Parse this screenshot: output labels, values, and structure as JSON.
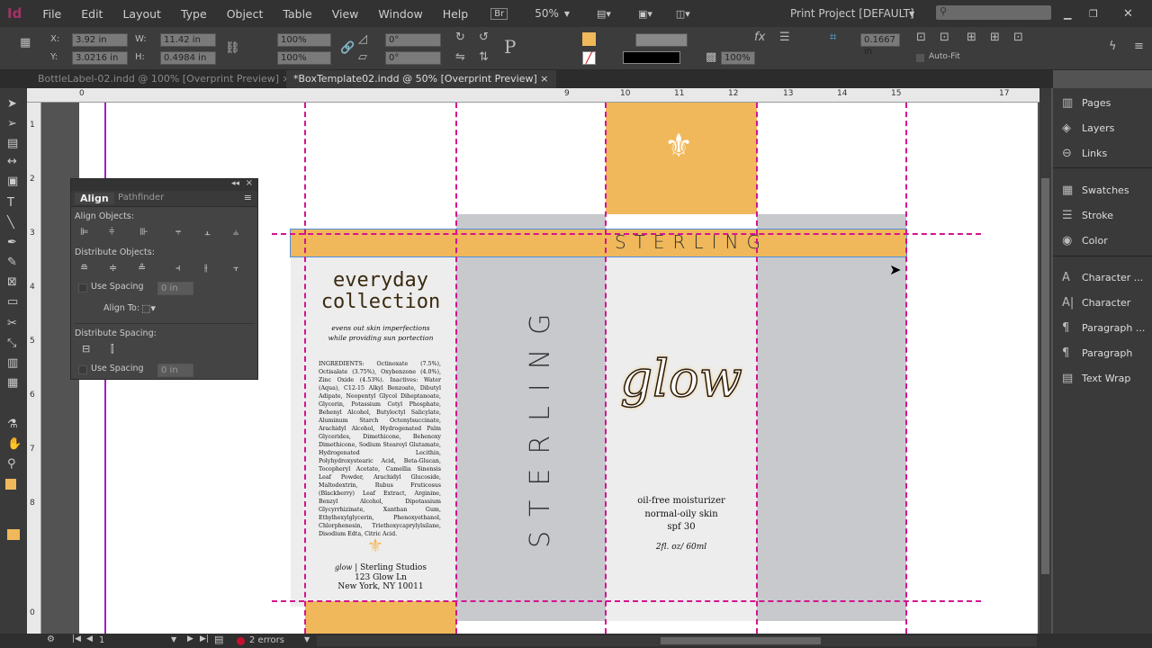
{
  "app": {
    "logo": "Id",
    "menus": [
      "File",
      "Edit",
      "Layout",
      "Type",
      "Object",
      "Table",
      "View",
      "Window",
      "Help"
    ],
    "bridge": "Br",
    "zoom": "50%",
    "workspace": "Print Project [DEFAULT]",
    "search_placeholder": ""
  },
  "control": {
    "x_label": "X:",
    "x": "3.92 in",
    "y_label": "Y:",
    "y": "3.0216 in",
    "w_label": "W:",
    "w": "11.42 in",
    "h_label": "H:",
    "h": "0.4984 in",
    "scale_x": "100%",
    "scale_y": "100%",
    "rotate": "0°",
    "shear": "0°",
    "stroke_weight": "",
    "opacity": "100%",
    "frame_offset": "0.1667 in",
    "autofit": "Auto-Fit",
    "fill_color": "#f0b85a"
  },
  "tabs": [
    {
      "label": "BottleLabel-02.indd @ 100% [Overprint Preview]",
      "active": false
    },
    {
      "label": "*BoxTemplate02.indd @ 50% [Overprint Preview]",
      "active": true
    }
  ],
  "ruler": {
    "top": [
      "0",
      "9",
      "10",
      "11",
      "12",
      "13",
      "14",
      "15",
      "17"
    ],
    "left": [
      "1",
      "2",
      "3",
      "4",
      "5",
      "6",
      "7",
      "8",
      "0"
    ]
  },
  "align_panel": {
    "tab_align": "Align",
    "tab_pathfinder": "Pathfinder",
    "align_objects": "Align Objects:",
    "distribute_objects": "Distribute Objects:",
    "use_spacing": "Use Spacing",
    "spacing_value": "0 in",
    "align_to": "Align To:",
    "distribute_spacing": "Distribute Spacing:",
    "use_spacing2": "Use Spacing",
    "spacing_value2": "0 in"
  },
  "right_panel": {
    "items": [
      {
        "label": "Pages",
        "icon": "pages-icon"
      },
      {
        "label": "Layers",
        "icon": "layers-icon"
      },
      {
        "label": "Links",
        "icon": "links-icon"
      },
      {
        "label": "Swatches",
        "icon": "swatches-icon"
      },
      {
        "label": "Stroke",
        "icon": "stroke-icon"
      },
      {
        "label": "Color",
        "icon": "color-icon"
      },
      {
        "label": "Character ...",
        "icon": "character-styles-icon"
      },
      {
        "label": "Character",
        "icon": "character-icon"
      },
      {
        "label": "Paragraph ...",
        "icon": "paragraph-styles-icon"
      },
      {
        "label": "Paragraph",
        "icon": "paragraph-icon"
      },
      {
        "label": "Text Wrap",
        "icon": "text-wrap-icon"
      }
    ]
  },
  "design": {
    "banner": "STERLING",
    "side_vertical": "STERLING",
    "headline1": "everyday",
    "headline2": "collection",
    "tagline1": "evens out skin imperfections",
    "tagline2": "while providing sun portection",
    "ingredients": "INGREDIENTS: Octinoxate (7.5%), Octisalate (3.75%), Oxybenzone (4.0%), Zinc Oxide (4.53%). Inactives: Water (Aqua), C12-15 Alkyl Benzoate, Dibutyl Adipate, Neopentyl Glycol Diheptanoate, Glycerin, Potassium Cetyl Phosphate, Behenyl Alcohol, Butyloctyl Salicylate, Aluminum Starch Octenylsuccinate, Arachidyl Alcohol, Hydrogenated Palm Glycerides, Dimethicone, Behenoxy Dimethicone, Sodium Stearoyl Glutamate, Hydrogenated Lecithin, Polyhydroxystearic Acid, Beta-Glucan, Tocopheryl Acetate, Camellia Sinensis Leaf Powder, Arachidyl Glucoside, Maltodextrin, Rubus Fruticosus (Blackberry) Leaf Extract, Arginine, Benzyl Alcohol, Dipotassium Glycyrrhizinate, Xanthan Gum, Ethylhexylglycerin, Phenoxyethanol, Chlorphenesin, Triethoxycaprylylsilane, Disodium Edta, Citric Acid.",
    "brand_small": "glow",
    "company": "| Sterling Studios",
    "address1": "123 Glow Ln",
    "address2": "New York, NY 10011",
    "logo_text": "glow",
    "desc1": "oil-free moisturizer",
    "desc2": "normal-oily skin",
    "desc3": "spf 30",
    "volume": "2fl. oz/ 60ml",
    "colors": {
      "gold": "#f0b85a",
      "gray": "#c8c9cd",
      "light": "#ededed",
      "guide": "#d4148f"
    }
  },
  "status": {
    "page": "1",
    "errors": "2 errors"
  }
}
